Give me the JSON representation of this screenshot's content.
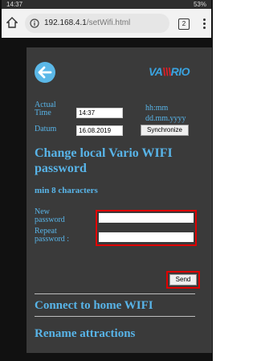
{
  "statusbar": {
    "time": "14:37",
    "right": "53%"
  },
  "browser": {
    "url_host": "192.168.4.1",
    "url_path": "/setWifi.html",
    "tab_count": "2"
  },
  "logo": {
    "text_a": "VA",
    "text_bars": "\\\\\\",
    "text_b": "RIO"
  },
  "time_row": {
    "label": "Actual Time",
    "value": "14:37",
    "hint": "hh:mm"
  },
  "date_row": {
    "label": "Datum",
    "value": "16.08.2019",
    "hint": "dd.mm.yyyy"
  },
  "sync_button": "Synchronize",
  "change_pwd": {
    "title": "Change local Vario WIFI password",
    "subtitle": "min 8 characters",
    "new_label": "New password",
    "repeat_label": "Repeat password :",
    "send_label": "Send"
  },
  "sections": {
    "connect": "Connect to home WIFI",
    "rename": "Rename attractions"
  },
  "colors": {
    "accent": "#58b4e8",
    "highlight": "#e00000",
    "panel": "#3a3a3a"
  }
}
